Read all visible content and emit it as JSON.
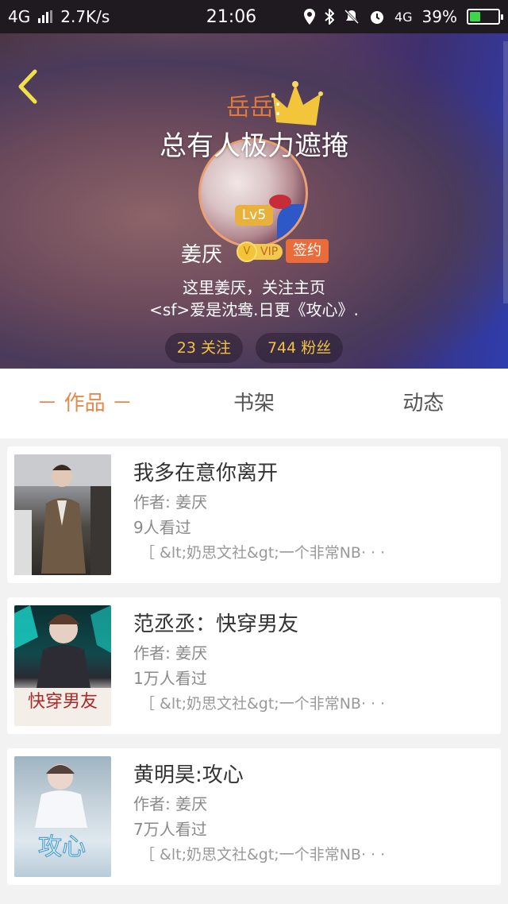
{
  "status_bar": {
    "network": "4G",
    "speed": "2.7K/s",
    "time": "21:06",
    "network_right": "4G",
    "battery": "39%"
  },
  "profile": {
    "title_name": "岳岳",
    "title_colon": ":",
    "title_text": "总有人极力遮掩",
    "level": "Lv5",
    "username": "姜厌",
    "vip_label": "VIP",
    "vip_coin": "V",
    "signed_label": "签约",
    "bio_line1": "这里姜厌，关注主页",
    "bio_line2": "<sf>爱是沈鸯.日更《攻心》.",
    "following": "23 关注",
    "followers": "744 粉丝"
  },
  "tabs": [
    {
      "label": "－ 作品 －",
      "active": true
    },
    {
      "label": "书架",
      "active": false
    },
    {
      "label": "动态",
      "active": false
    }
  ],
  "books": [
    {
      "title": "我多在意你离开",
      "author": "作者: 姜厌",
      "views": "9人看过",
      "desc": "［ &lt;奶思文社&gt;一个非常NB· · ·"
    },
    {
      "title": "范丞丞：快穿男友",
      "author": "作者: 姜厌",
      "views": "1万人看过",
      "desc": "［ &lt;奶思文社&gt;一个非常NB· · ·",
      "cover_text": "快穿男友"
    },
    {
      "title": "黄明昊:攻心",
      "author": "作者: 姜厌",
      "views": "7万人看过",
      "desc": "［ &lt;奶思文社&gt;一个非常NB· · ·",
      "cover_text": "攻心"
    }
  ],
  "colors": {
    "accent": "#e58a4c",
    "gold": "#f1c244",
    "signed": "#ea6c3a"
  }
}
